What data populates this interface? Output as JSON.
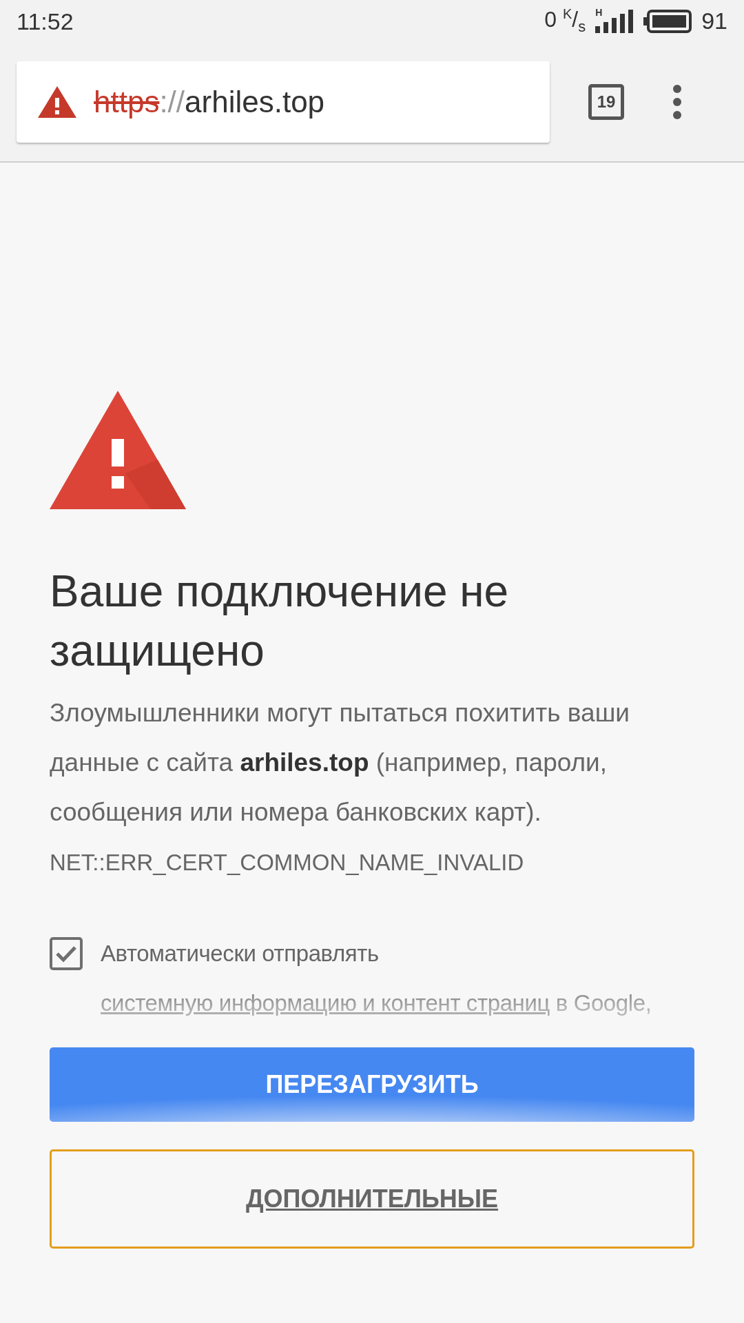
{
  "status_bar": {
    "time": "11:52",
    "net_speed": "0 $^{K}$/$_{s}$",
    "network": "H",
    "battery": "91"
  },
  "toolbar": {
    "address": {
      "secure": false,
      "scheme": "https",
      "separator": "://",
      "host": "arhiles.top"
    },
    "tab_count": "19"
  },
  "interstitial": {
    "heading": "Ваше подключение не защищено",
    "body": "Злоумышленники могут пытаться похитить ваши данные с сайта **arhiles.top** (например, пароли, сообщения или номера банковских карт).",
    "error_code": "NET::ERR_CERT_COMMON_NAME_INVALID",
    "report": {
      "checked": true,
      "before": "Автоматически отправлять",
      "link": "системную информацию и контент страниц",
      "after": "в Google,"
    },
    "buttons": [
      {
        "kind": "primary",
        "label": "ПЕРЕЗАГРУЗИТЬ",
        "focused": false
      },
      {
        "kind": "secondary",
        "label": "ДОПОЛНИТЕЛЬНЫЕ",
        "focused": true
      }
    ]
  }
}
